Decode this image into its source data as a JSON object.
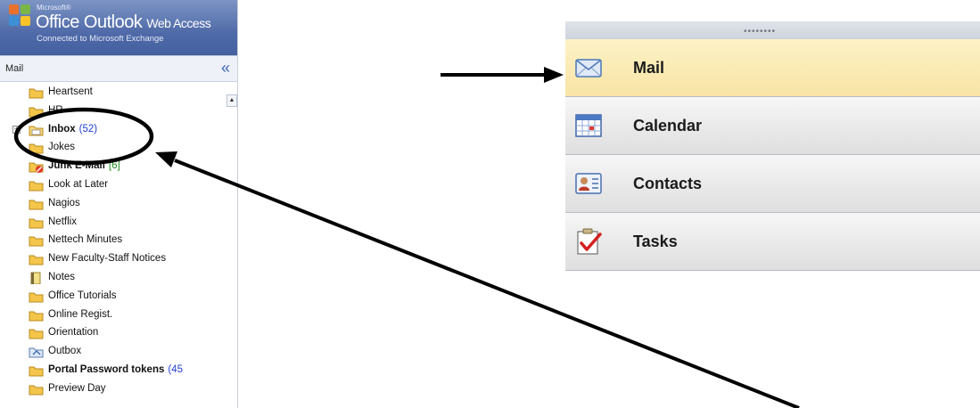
{
  "header": {
    "microsoft_label": "Microsoft®",
    "product_main": "Office Outlook",
    "product_suffix": "Web Access",
    "subtitle": "Connected to Microsoft Exchange"
  },
  "mail_bar": {
    "title": "Mail",
    "collapse_glyph": "«"
  },
  "folders": [
    {
      "name": "Heartsent",
      "icon": "folder-icon",
      "bold": false,
      "count": ""
    },
    {
      "name": "HR",
      "icon": "folder-icon",
      "bold": false,
      "count": ""
    },
    {
      "name": "Inbox",
      "icon": "inbox-folder-icon",
      "bold": true,
      "count": "(52)",
      "count_color": "#1f3fd1",
      "expandable": true
    },
    {
      "name": "Jokes",
      "icon": "folder-icon",
      "bold": false,
      "count": ""
    },
    {
      "name": "Junk E-Mail",
      "icon": "junk-folder-icon",
      "bold": true,
      "count": "[6]",
      "count_color": "#1a8a1a"
    },
    {
      "name": "Look at Later",
      "icon": "folder-icon",
      "bold": false,
      "count": ""
    },
    {
      "name": "Nagios",
      "icon": "folder-icon",
      "bold": false,
      "count": ""
    },
    {
      "name": "Netflix",
      "icon": "folder-icon",
      "bold": false,
      "count": ""
    },
    {
      "name": "Nettech Minutes",
      "icon": "folder-icon",
      "bold": false,
      "count": ""
    },
    {
      "name": "New Faculty-Staff Notices",
      "icon": "folder-icon",
      "bold": false,
      "count": ""
    },
    {
      "name": "Notes",
      "icon": "notes-icon",
      "bold": false,
      "count": ""
    },
    {
      "name": "Office Tutorials",
      "icon": "folder-icon",
      "bold": false,
      "count": ""
    },
    {
      "name": "Online Regist.",
      "icon": "folder-icon",
      "bold": false,
      "count": ""
    },
    {
      "name": "Orientation",
      "icon": "folder-icon",
      "bold": false,
      "count": ""
    },
    {
      "name": "Outbox",
      "icon": "outbox-icon",
      "bold": false,
      "count": ""
    },
    {
      "name": "Portal Password tokens",
      "icon": "folder-icon",
      "bold": true,
      "count": "(45",
      "count_color": "#1f3fd1"
    },
    {
      "name": "Preview Day",
      "icon": "folder-icon",
      "bold": false,
      "count": ""
    }
  ],
  "nav": {
    "grip": "••••••••",
    "items": [
      {
        "label": "Mail",
        "icon": "mail-envelope-icon",
        "selected": true
      },
      {
        "label": "Calendar",
        "icon": "calendar-icon",
        "selected": false
      },
      {
        "label": "Contacts",
        "icon": "contacts-card-icon",
        "selected": false
      },
      {
        "label": "Tasks",
        "icon": "tasks-checklist-icon",
        "selected": false
      }
    ]
  },
  "colors": {
    "header_blue": "#4f6aa8",
    "selected_nav": "#f8e4a5",
    "folder_yellow": "#f3c64b",
    "annotation": "#000000"
  }
}
